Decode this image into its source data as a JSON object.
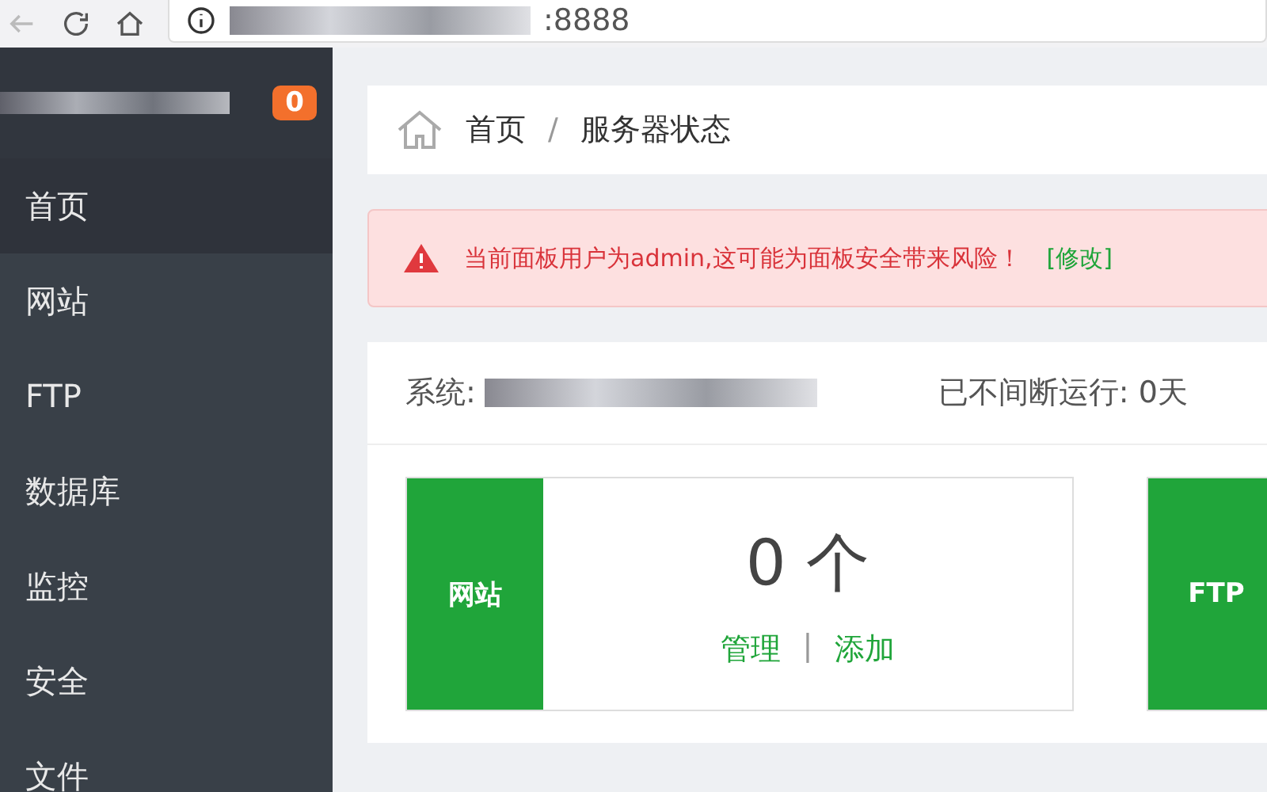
{
  "browser": {
    "url_visible": ":8888"
  },
  "sidebar": {
    "badge": "0",
    "items": [
      {
        "label": "首页",
        "selected": true
      },
      {
        "label": "网站",
        "selected": false
      },
      {
        "label": "FTP",
        "selected": false
      },
      {
        "label": "数据库",
        "selected": false
      },
      {
        "label": "监控",
        "selected": false
      },
      {
        "label": "安全",
        "selected": false
      },
      {
        "label": "文件",
        "selected": false
      }
    ]
  },
  "breadcrumb": [
    "首页",
    "服务器状态"
  ],
  "breadcrumb_separator": "/",
  "alert": {
    "message": "当前面板用户为admin,这可能为面板安全带来风险！",
    "link": "[修改]"
  },
  "system": {
    "label": "系统:",
    "uptime": "已不间断运行: 0天"
  },
  "stats": [
    {
      "label": "网站",
      "count": "0 个",
      "actions": [
        "管理",
        "添加"
      ],
      "separator": "|"
    },
    {
      "label": "FTP"
    }
  ]
}
